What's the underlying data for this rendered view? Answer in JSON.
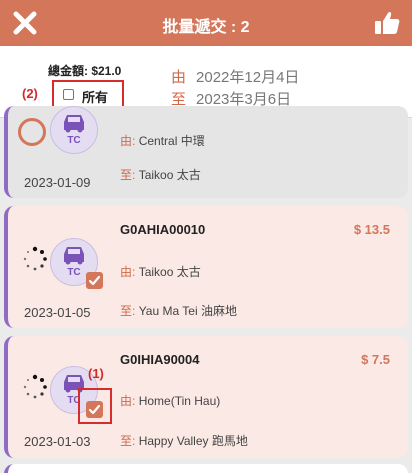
{
  "header": {
    "title": "批量遞交 : 2",
    "close_icon": "close-icon",
    "like_icon": "thumbs-up-icon",
    "color": "#d4765a"
  },
  "filter": {
    "total_label": "總金額: $21.0",
    "select_all_label": "所有",
    "select_all_checked": false,
    "from_key": "由",
    "from_date": "2022年12月4日",
    "to_key": "至",
    "to_date": "2023年3月6日"
  },
  "annotations": {
    "marker_1": "(1)",
    "marker_2": "(2)"
  },
  "orders": [
    {
      "order_no": "",
      "price": "",
      "vehicle_tag": "TC",
      "from_key": "由:",
      "from": "Central 中環",
      "to_key": "至:",
      "to": "Taikoo 太古",
      "date": "2023-01-09",
      "selected": false
    },
    {
      "order_no": "G0AHIA00010",
      "price": "$ 13.5",
      "vehicle_tag": "TC",
      "from_key": "由:",
      "from": "Taikoo 太古",
      "to_key": "至:",
      "to": "Yau Ma Tei 油麻地",
      "date": "2023-01-05",
      "selected": true
    },
    {
      "order_no": "G0IHIA90004",
      "price": "$ 7.5",
      "vehicle_tag": "TC",
      "from_key": "由:",
      "from": "Home(Tin Hau)",
      "to_key": "至:",
      "to": "Happy Valley 跑馬地",
      "date": "2023-01-03",
      "selected": true
    }
  ]
}
